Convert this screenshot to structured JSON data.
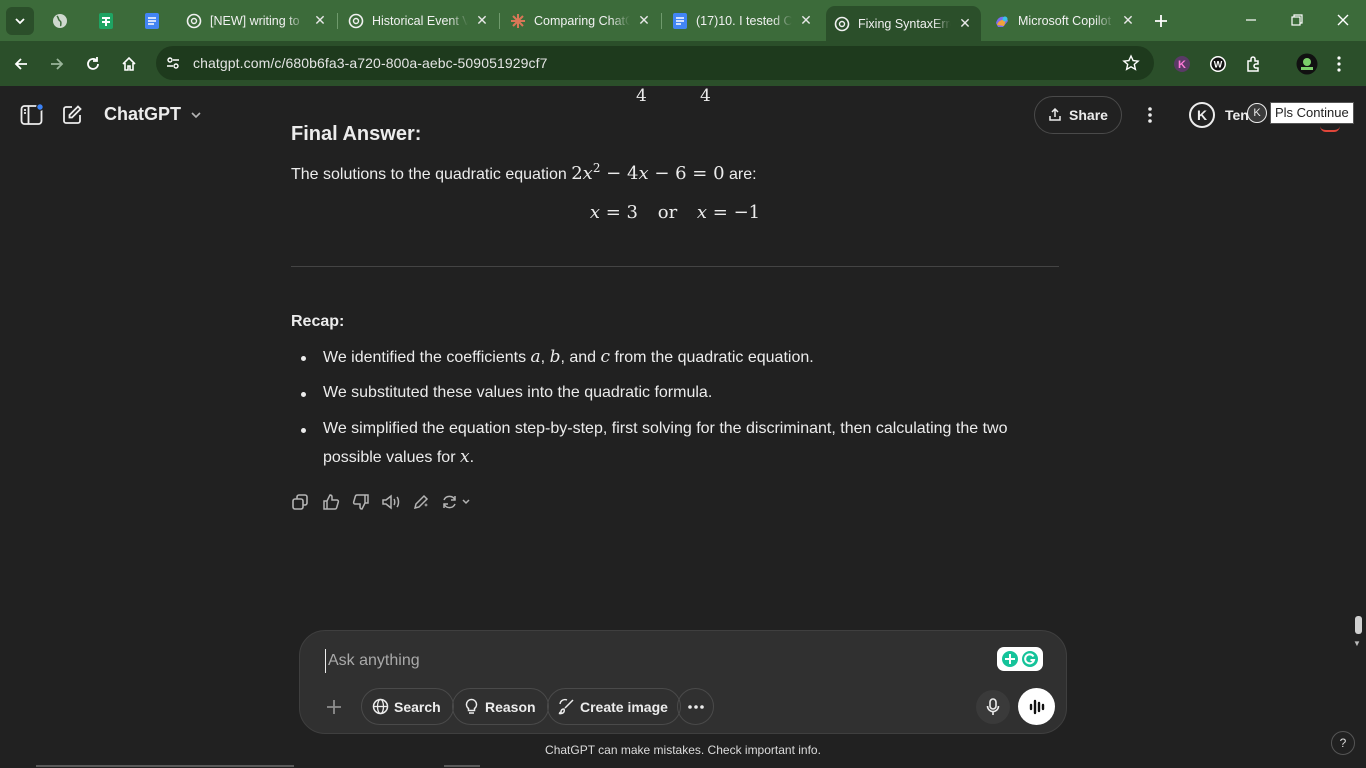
{
  "browser": {
    "tabs": [
      {
        "title": "[NEW] writing to",
        "favicon": "chatgpt-icon"
      },
      {
        "title": "Historical Event V",
        "favicon": "chatgpt-icon"
      },
      {
        "title": "Comparing ChatG",
        "favicon": "claude-icon"
      },
      {
        "title": "(17)10. I tested C",
        "favicon": "google-docs-icon"
      },
      {
        "title": "Fixing SyntaxErro",
        "favicon": "chatgpt-icon",
        "active": true
      },
      {
        "title": "Microsoft Copilot",
        "favicon": "copilot-icon"
      }
    ],
    "url": "chatgpt.com/c/680b6fa3-a720-800a-aebc-509051929cf7"
  },
  "header": {
    "model": "ChatGPT",
    "share_label": "Share",
    "avatar_letter": "K",
    "user_name": "Ten",
    "tooltip": "Pls Continue"
  },
  "content": {
    "frac_top": [
      "4",
      "4"
    ],
    "heading": "Final Answer:",
    "solutions_intro": "The solutions to the quadratic equation",
    "equation": {
      "a": "2",
      "var": "x",
      "exp": "2",
      "mid": " − 4",
      "var2": "x",
      "rest": " − 6 = 0"
    },
    "solutions_suffix": " are:",
    "display": {
      "lhs1": "x",
      "rhs1": " = 3",
      "or": "or",
      "lhs2": "x",
      "rhs2": " = −1"
    },
    "recap_title": "Recap:",
    "recap": [
      {
        "pre": "We identified the coefficients ",
        "m1": "a",
        "s1": ", ",
        "m2": "b",
        "s2": ", and ",
        "m3": "c",
        "post": " from the quadratic equation."
      },
      {
        "text": "We substituted these values into the quadratic formula."
      },
      {
        "line1": "We simplified the equation step-by-step, first solving for the discriminant, then calculating the two",
        "line2pre": "possible values for ",
        "m": "x",
        "line2post": "."
      }
    ]
  },
  "composer": {
    "placeholder": "Ask anything",
    "search_label": "Search",
    "reason_label": "Reason",
    "create_image_label": "Create image"
  },
  "footer": {
    "disclaimer": "ChatGPT can make mistakes. Check important info.",
    "help": "?"
  },
  "colors": {
    "browser_tabbar": "#3c6b3a",
    "browser_toolbar": "#2b4f2a",
    "page_bg": "#212121",
    "composer_bg": "#303030"
  }
}
